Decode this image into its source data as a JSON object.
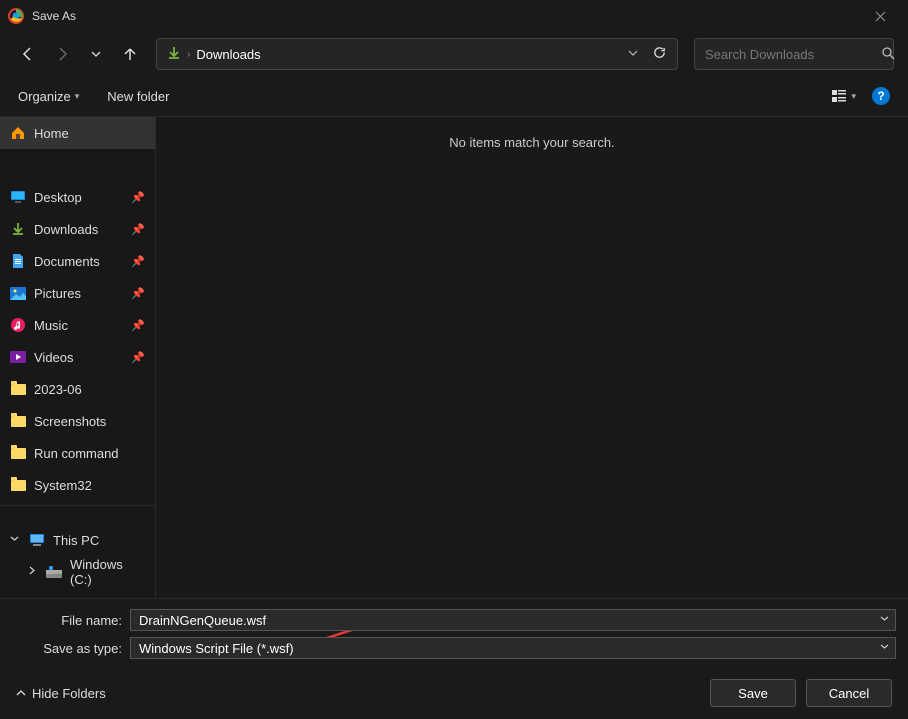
{
  "title": "Save As",
  "breadcrumb": {
    "location": "Downloads"
  },
  "search": {
    "placeholder": "Search Downloads"
  },
  "toolbar": {
    "organize": "Organize",
    "newfolder": "New folder"
  },
  "sidebar": {
    "home": "Home",
    "desktop": "Desktop",
    "downloads": "Downloads",
    "documents": "Documents",
    "pictures": "Pictures",
    "music": "Music",
    "videos": "Videos",
    "folder1": "2023-06",
    "folder2": "Screenshots",
    "folder3": "Run command",
    "folder4": "System32",
    "thispc": "This PC",
    "drive": "Windows (C:)"
  },
  "content": {
    "empty": "No items match your search."
  },
  "fields": {
    "fname_label": "File name:",
    "fname_value": "DrainNGenQueue.wsf",
    "ftype_label": "Save as type:",
    "ftype_value": "Windows Script File (*.wsf)"
  },
  "buttons": {
    "hide": "Hide Folders",
    "save": "Save",
    "cancel": "Cancel"
  }
}
